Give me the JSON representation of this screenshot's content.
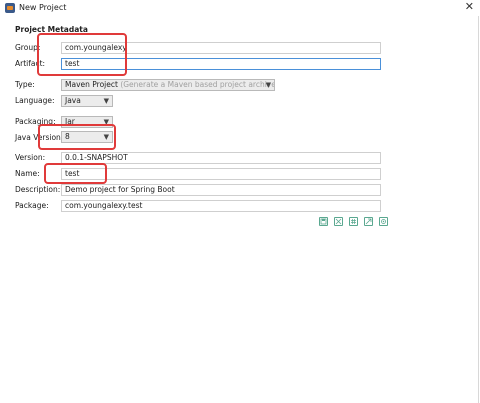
{
  "window": {
    "title": "New Project"
  },
  "form": {
    "section_title": "Project Metadata",
    "group": {
      "label": "Group:",
      "value": "com.youngalexy"
    },
    "artifact": {
      "label": "Artifact:",
      "value": "test"
    },
    "type": {
      "label": "Type:",
      "value": "Maven Project",
      "hint": "(Generate a Maven based project archive.)"
    },
    "language": {
      "label": "Language:",
      "value": "Java"
    },
    "packaging": {
      "label": "Packaging:",
      "value": "Jar"
    },
    "java_version": {
      "label": "Java Version:",
      "value": "8"
    },
    "version": {
      "label": "Version:",
      "value": "0.0.1-SNAPSHOT"
    },
    "name": {
      "label": "Name:",
      "value": "test"
    },
    "description": {
      "label": "Description:",
      "value": "Demo project for Spring Boot"
    },
    "package": {
      "label": "Package:",
      "value": "com.youngalexy.test"
    }
  },
  "toolbar_icons": [
    "save-icon",
    "expand-icon",
    "grid-icon",
    "export-icon",
    "settings-icon"
  ],
  "colors": {
    "highlight": "#e03a3a",
    "focus_border": "#4a90d9",
    "icon_accent": "#5aa890"
  }
}
